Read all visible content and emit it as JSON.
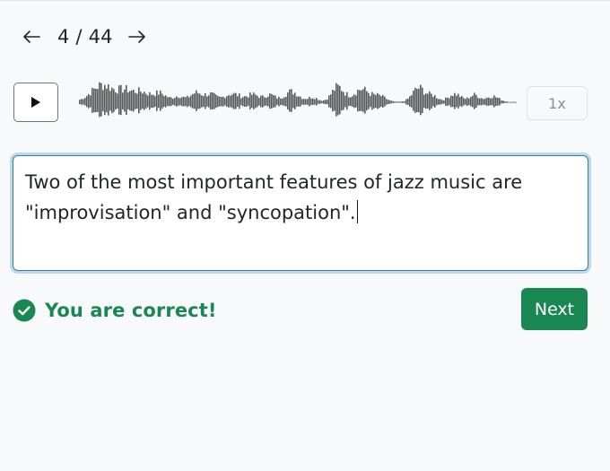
{
  "navigation": {
    "prev_icon": "arrow-left-icon",
    "next_icon": "arrow-right-icon",
    "counter": "4 / 44"
  },
  "player": {
    "play_icon": "play-icon",
    "speed_label": "1x",
    "waveform_color": "#595959"
  },
  "answer": {
    "text": "Two of the most important features of jazz music are \"improvisation\" and \"syncopation\"."
  },
  "result": {
    "icon": "check-circle-icon",
    "message": "You are correct!",
    "color": "#198754"
  },
  "actions": {
    "next_label": "Next"
  }
}
